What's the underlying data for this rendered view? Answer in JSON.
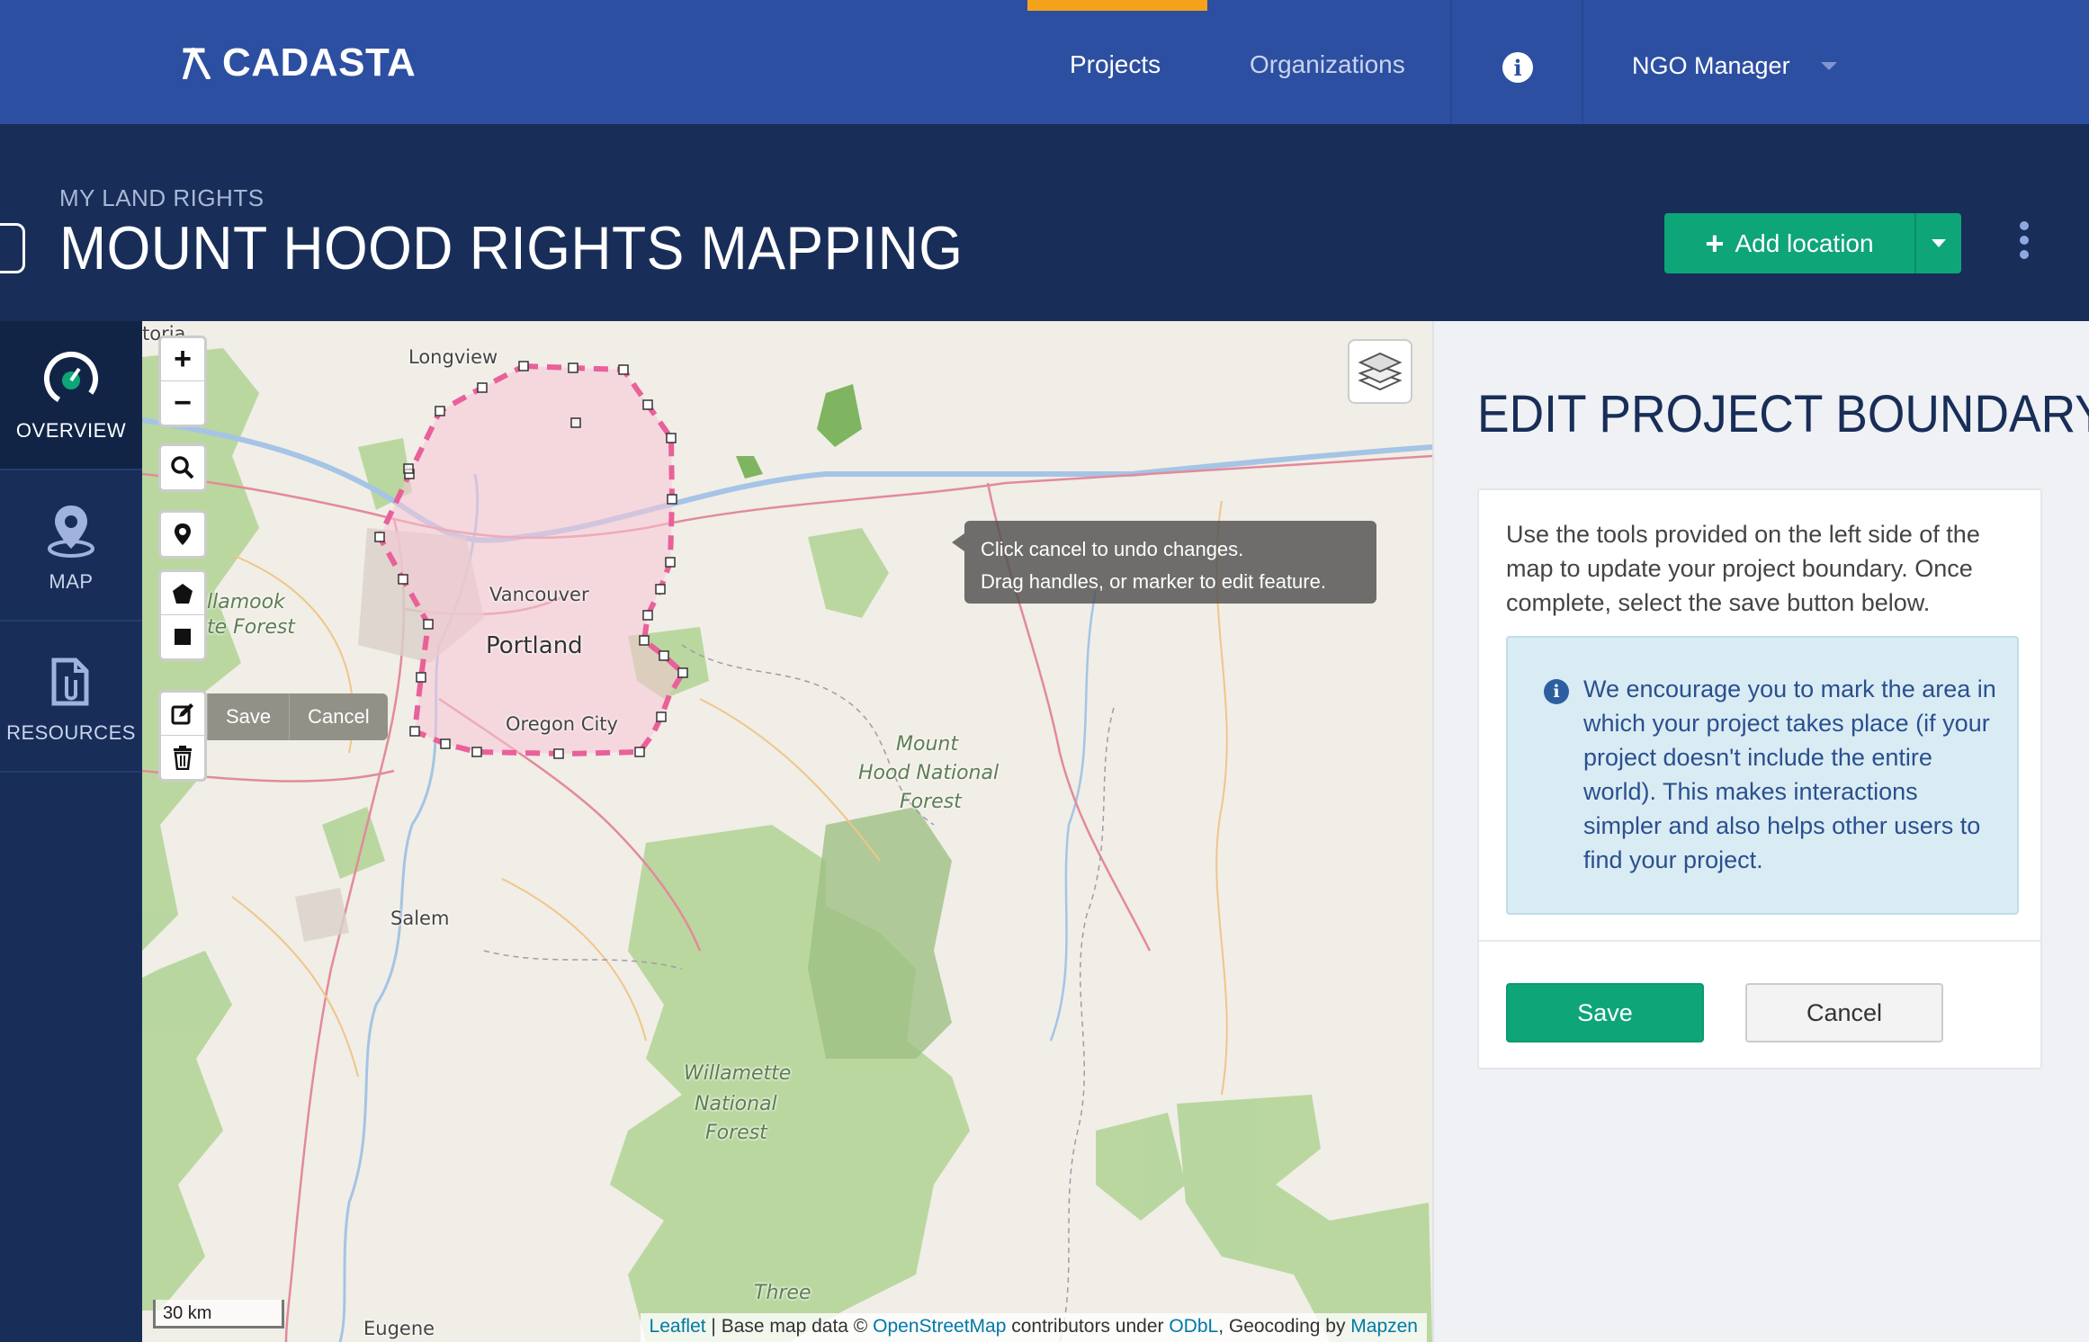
{
  "nav": {
    "brand": "CADASTA",
    "links": [
      "Projects",
      "Organizations"
    ],
    "active_link": "Projects",
    "user": "NGO Manager",
    "accent_color": "#f5a21b"
  },
  "header": {
    "organization": "MY LAND RIGHTS",
    "project_title": "MOUNT HOOD RIGHTS MAPPING",
    "add_location_label": "Add location"
  },
  "sidebar": {
    "items": [
      {
        "label": "OVERVIEW",
        "icon": "dashboard-gauge-icon"
      },
      {
        "label": "MAP",
        "icon": "map-pin-icon"
      },
      {
        "label": "RESOURCES",
        "icon": "attachment-document-icon"
      }
    ],
    "active": "OVERVIEW"
  },
  "map": {
    "edit_save": "Save",
    "edit_cancel": "Cancel",
    "tooltip_line1": "Click cancel to undo changes.",
    "tooltip_line2": "Drag handles, or marker to edit feature.",
    "scale": "30 km",
    "places": {
      "longview": "Longview",
      "vancouver": "Vancouver",
      "portland": "Portland",
      "oregon_city": "Oregon City",
      "salem": "Salem",
      "eugene": "Eugene",
      "tillamook1": "llamook",
      "tillamook2": "te Forest",
      "astoria": "toria",
      "mthood1": "Mount",
      "mthood2": "Hood National",
      "mthood3": "Forest",
      "will1": "Willamette",
      "will2": "National",
      "will3": "Forest",
      "three": "Three"
    },
    "attribution": {
      "leaflet": "Leaflet",
      "sep": " | Base map data © ",
      "osm": "OpenStreetMap",
      "mid": " contributors under ",
      "odbl": "ODbL",
      "geo": ", Geocoding by ",
      "mapzen": "Mapzen"
    }
  },
  "panel": {
    "title": "EDIT PROJECT BOUNDARY",
    "intro": "Use the tools provided on the left side of the map to update your project boundary. Once complete, select the save button below.",
    "notice": "We encourage you to mark the area in which your project takes place (if your project doesn't include the entire world). This makes interactions simpler and also helps other users to find your project.",
    "save_label": "Save",
    "cancel_label": "Cancel"
  }
}
